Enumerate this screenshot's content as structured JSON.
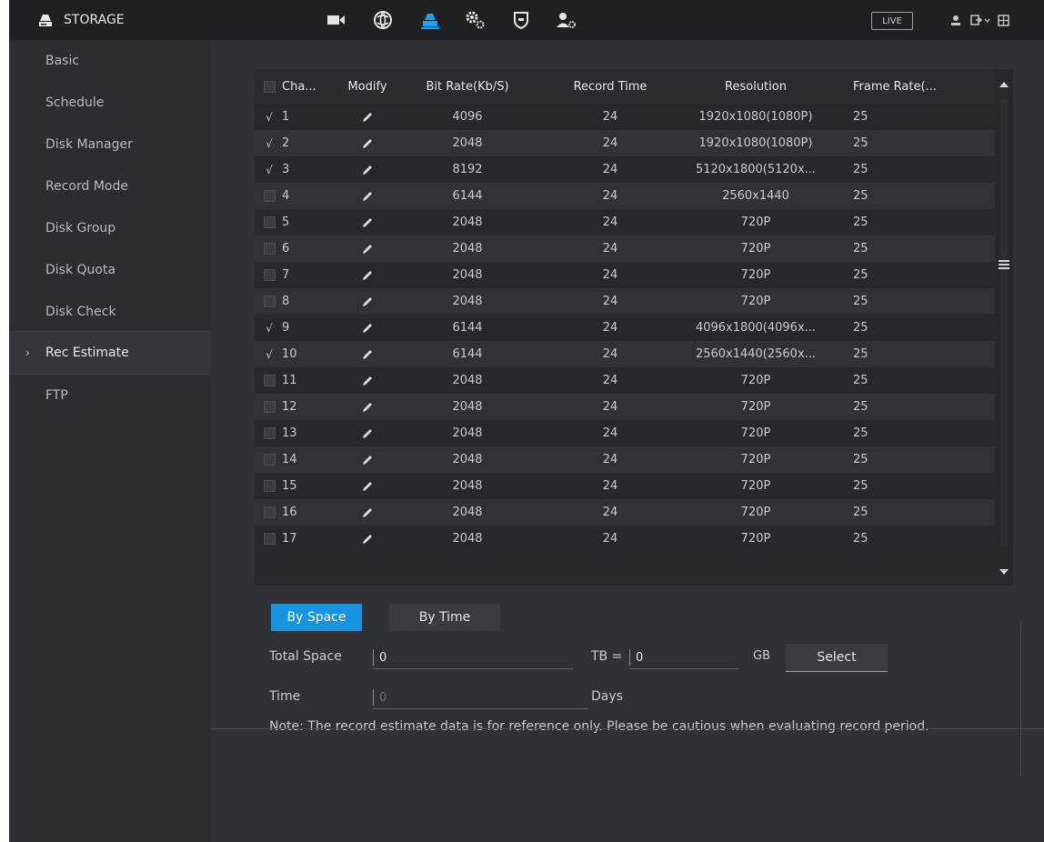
{
  "app": {
    "title": "STORAGE",
    "live_label": "LIVE"
  },
  "sidebar": {
    "items": [
      {
        "label": "Basic"
      },
      {
        "label": "Schedule"
      },
      {
        "label": "Disk Manager"
      },
      {
        "label": "Record Mode"
      },
      {
        "label": "Disk Group"
      },
      {
        "label": "Disk Quota"
      },
      {
        "label": "Disk Check"
      },
      {
        "label": "Rec Estimate",
        "active": true
      },
      {
        "label": "FTP"
      }
    ]
  },
  "table": {
    "headers": {
      "channel": "Cha...",
      "modify": "Modify",
      "bitrate": "Bit Rate(Kb/S)",
      "record_time": "Record Time",
      "resolution": "Resolution",
      "frame_rate": "Frame Rate(..."
    },
    "rows": [
      {
        "checked": true,
        "channel": "1",
        "bitrate": "4096",
        "record_time": "24",
        "resolution": "1920x1080(1080P)",
        "frame_rate": "25"
      },
      {
        "checked": true,
        "channel": "2",
        "bitrate": "2048",
        "record_time": "24",
        "resolution": "1920x1080(1080P)",
        "frame_rate": "25"
      },
      {
        "checked": true,
        "channel": "3",
        "bitrate": "8192",
        "record_time": "24",
        "resolution": "5120x1800(5120x...",
        "frame_rate": "25"
      },
      {
        "checked": false,
        "channel": "4",
        "bitrate": "6144",
        "record_time": "24",
        "resolution": "2560x1440",
        "frame_rate": "25"
      },
      {
        "checked": false,
        "channel": "5",
        "bitrate": "2048",
        "record_time": "24",
        "resolution": "720P",
        "frame_rate": "25"
      },
      {
        "checked": false,
        "channel": "6",
        "bitrate": "2048",
        "record_time": "24",
        "resolution": "720P",
        "frame_rate": "25"
      },
      {
        "checked": false,
        "channel": "7",
        "bitrate": "2048",
        "record_time": "24",
        "resolution": "720P",
        "frame_rate": "25"
      },
      {
        "checked": false,
        "channel": "8",
        "bitrate": "2048",
        "record_time": "24",
        "resolution": "720P",
        "frame_rate": "25"
      },
      {
        "checked": true,
        "channel": "9",
        "bitrate": "6144",
        "record_time": "24",
        "resolution": "4096x1800(4096x...",
        "frame_rate": "25"
      },
      {
        "checked": true,
        "channel": "10",
        "bitrate": "6144",
        "record_time": "24",
        "resolution": "2560x1440(2560x...",
        "frame_rate": "25"
      },
      {
        "checked": false,
        "channel": "11",
        "bitrate": "2048",
        "record_time": "24",
        "resolution": "720P",
        "frame_rate": "25"
      },
      {
        "checked": false,
        "channel": "12",
        "bitrate": "2048",
        "record_time": "24",
        "resolution": "720P",
        "frame_rate": "25"
      },
      {
        "checked": false,
        "channel": "13",
        "bitrate": "2048",
        "record_time": "24",
        "resolution": "720P",
        "frame_rate": "25"
      },
      {
        "checked": false,
        "channel": "14",
        "bitrate": "2048",
        "record_time": "24",
        "resolution": "720P",
        "frame_rate": "25"
      },
      {
        "checked": false,
        "channel": "15",
        "bitrate": "2048",
        "record_time": "24",
        "resolution": "720P",
        "frame_rate": "25"
      },
      {
        "checked": false,
        "channel": "16",
        "bitrate": "2048",
        "record_time": "24",
        "resolution": "720P",
        "frame_rate": "25"
      },
      {
        "checked": false,
        "channel": "17",
        "bitrate": "2048",
        "record_time": "24",
        "resolution": "720P",
        "frame_rate": "25"
      }
    ]
  },
  "tabs": {
    "by_space": "By Space",
    "by_time": "By Time",
    "active": "by_space"
  },
  "form": {
    "total_space_label": "Total Space",
    "total_space_value": "0",
    "tb_label": "TB =",
    "gb_value": "0",
    "gb_label": "GB",
    "select_label": "Select",
    "time_label": "Time",
    "time_value": "0",
    "days_label": "Days"
  },
  "note": "Note: The record estimate data is for reference only. Please be cautious when evaluating record period.",
  "colors": {
    "accent": "#1794e0",
    "active_icon": "#1aa2f1",
    "background": "#2b2d31"
  }
}
